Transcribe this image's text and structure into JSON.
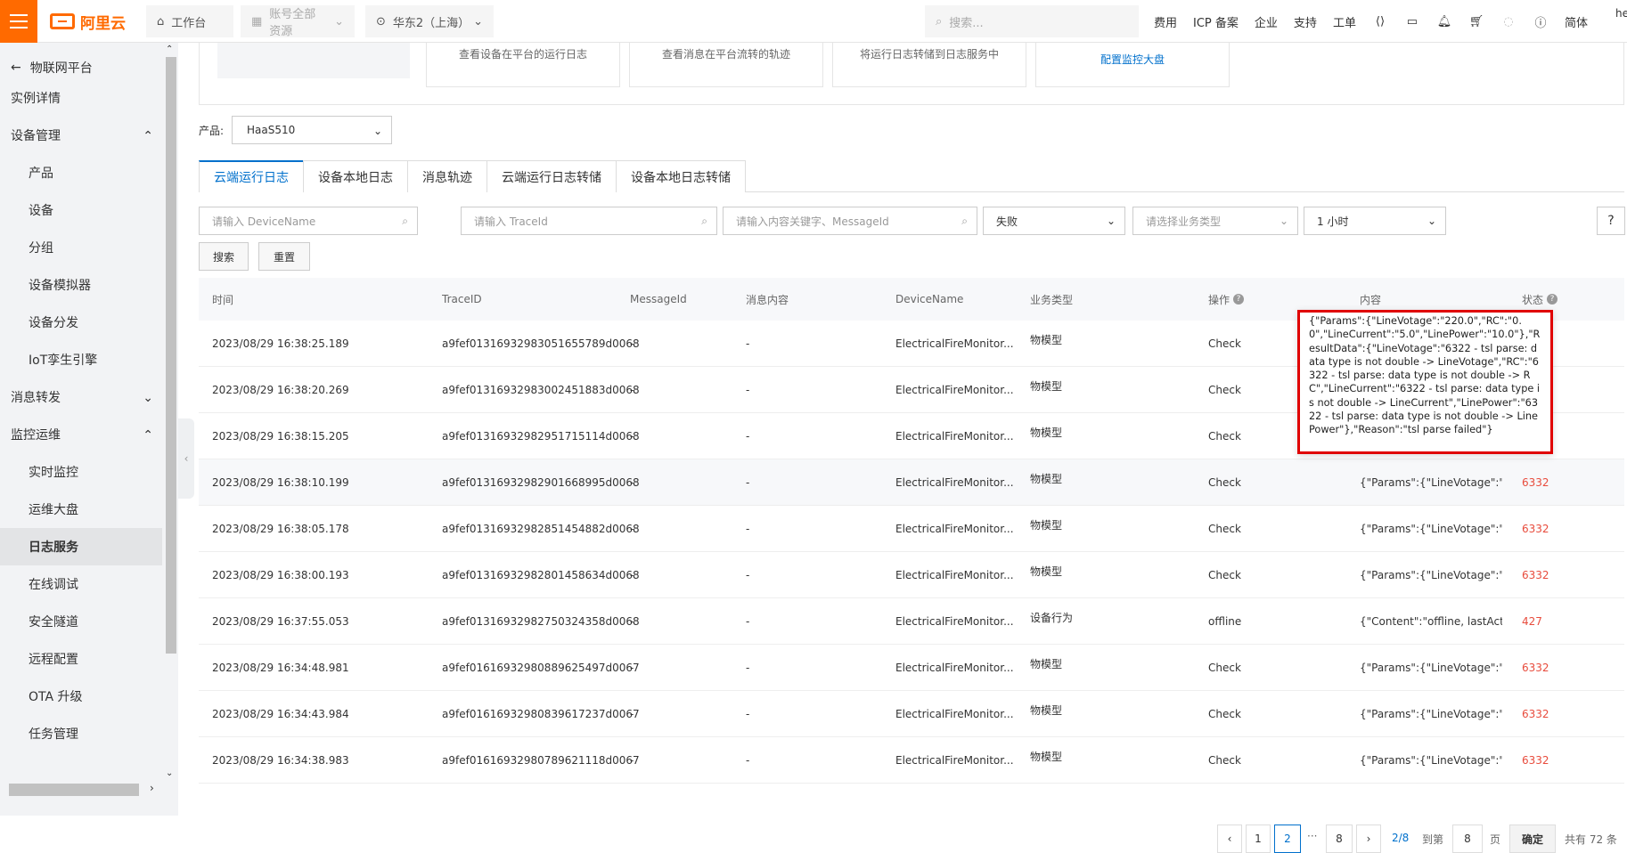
{
  "topbar": {
    "logo_text": "阿里云",
    "workbench": "工作台",
    "account": "账号全部资源",
    "region": "华东2（上海）",
    "search_placeholder": "搜索...",
    "links": [
      "费用",
      "ICP 备案",
      "企业",
      "支持",
      "工单"
    ],
    "lang": "简体",
    "user": "he"
  },
  "sidebar": {
    "back_label": "物联网平台",
    "items": [
      {
        "label": "实例详情",
        "level": "top"
      },
      {
        "label": "设备管理",
        "level": "top",
        "expanded": true
      },
      {
        "label": "产品",
        "level": "sub"
      },
      {
        "label": "设备",
        "level": "sub"
      },
      {
        "label": "分组",
        "level": "sub"
      },
      {
        "label": "设备模拟器",
        "level": "sub"
      },
      {
        "label": "设备分发",
        "level": "sub"
      },
      {
        "label": "IoT孪生引擎",
        "level": "sub"
      },
      {
        "label": "消息转发",
        "level": "top",
        "expanded": false
      },
      {
        "label": "监控运维",
        "level": "top",
        "expanded": true
      },
      {
        "label": "实时监控",
        "level": "sub"
      },
      {
        "label": "运维大盘",
        "level": "sub"
      },
      {
        "label": "日志服务",
        "level": "sub",
        "active": true
      },
      {
        "label": "在线调试",
        "level": "sub"
      },
      {
        "label": "安全隧道",
        "level": "sub"
      },
      {
        "label": "远程配置",
        "level": "sub"
      },
      {
        "label": "OTA 升级",
        "level": "sub"
      },
      {
        "label": "任务管理",
        "level": "sub"
      }
    ]
  },
  "cards": [
    {
      "text": "查看设备在平台的运行日志"
    },
    {
      "text": "查看消息在平台流转的轨迹"
    },
    {
      "text": "将运行日志转储到日志服务中"
    },
    {
      "link": "配置监控大盘"
    }
  ],
  "product": {
    "label": "产品:",
    "value": "HaaS510"
  },
  "tabs": [
    "云端运行日志",
    "设备本地日志",
    "消息轨迹",
    "云端运行日志转储",
    "设备本地日志转储"
  ],
  "filters": {
    "device_placeholder": "请输入 DeviceName",
    "trace_placeholder": "请输入 TraceId",
    "content_placeholder": "请输入内容关键字、MessageId",
    "status": "失败",
    "biz_placeholder": "请选择业务类型",
    "time": "1 小时",
    "help": "?"
  },
  "buttons": {
    "search": "搜索",
    "reset": "重置"
  },
  "table": {
    "headers": [
      "时间",
      "TraceID",
      "MessageId",
      "消息内容",
      "DeviceName",
      "业务类型",
      "操作",
      "内容",
      "状态"
    ],
    "rows": [
      {
        "time": "2023/08/29 16:38:25.189",
        "trace": "a9fef01316932983051655789d0068",
        "msg": "-",
        "content": "-",
        "device": "ElectricalFireMonitor...",
        "biz": "物模型",
        "op": "Check",
        "body": "",
        "state": ""
      },
      {
        "time": "2023/08/29 16:38:20.269",
        "trace": "a9fef01316932983002451883d0068",
        "msg": "-",
        "content": "-",
        "device": "ElectricalFireMonitor...",
        "biz": "物模型",
        "op": "Check",
        "body": "",
        "state": ""
      },
      {
        "time": "2023/08/29 16:38:15.205",
        "trace": "a9fef01316932982951715114d0068",
        "msg": "-",
        "content": "-",
        "device": "ElectricalFireMonitor...",
        "biz": "物模型",
        "op": "Check",
        "body": "",
        "state": ""
      },
      {
        "time": "2023/08/29 16:38:10.199",
        "trace": "a9fef01316932982901668995d0068",
        "msg": "-",
        "content": "-",
        "device": "ElectricalFireMonitor...",
        "biz": "物模型",
        "op": "Check",
        "body": "{\"Params\":{\"LineVotage\":\"...",
        "state": "6332"
      },
      {
        "time": "2023/08/29 16:38:05.178",
        "trace": "a9fef01316932982851454882d0068",
        "msg": "-",
        "content": "-",
        "device": "ElectricalFireMonitor...",
        "biz": "物模型",
        "op": "Check",
        "body": "{\"Params\":{\"LineVotage\":\"...",
        "state": "6332"
      },
      {
        "time": "2023/08/29 16:38:00.193",
        "trace": "a9fef01316932982801458634d0068",
        "msg": "-",
        "content": "-",
        "device": "ElectricalFireMonitor...",
        "biz": "物模型",
        "op": "Check",
        "body": "{\"Params\":{\"LineVotage\":\"...",
        "state": "6332"
      },
      {
        "time": "2023/08/29 16:37:55.053",
        "trace": "a9fef01316932982750324358d0068",
        "msg": "-",
        "content": "-",
        "device": "ElectricalFireMonitor...",
        "biz": "设备行为",
        "op": "offline",
        "body": "{\"Content\":\"offline, lastAct...",
        "state": "427"
      },
      {
        "time": "2023/08/29 16:34:48.981",
        "trace": "a9fef01616932980889625497d0067",
        "msg": "-",
        "content": "-",
        "device": "ElectricalFireMonitor...",
        "biz": "物模型",
        "op": "Check",
        "body": "{\"Params\":{\"LineVotage\":\"...",
        "state": "6332"
      },
      {
        "time": "2023/08/29 16:34:43.984",
        "trace": "a9fef01616932980839617237d0067",
        "msg": "-",
        "content": "-",
        "device": "ElectricalFireMonitor...",
        "biz": "物模型",
        "op": "Check",
        "body": "{\"Params\":{\"LineVotage\":\"...",
        "state": "6332"
      },
      {
        "time": "2023/08/29 16:34:38.983",
        "trace": "a9fef01616932980789621118d0067",
        "msg": "-",
        "content": "-",
        "device": "ElectricalFireMonitor...",
        "biz": "物模型",
        "op": "Check",
        "body": "{\"Params\":{\"LineVotage\":\"...",
        "state": "6332"
      }
    ]
  },
  "popover": {
    "text": "{\"Params\":{\"LineVotage\":\"220.0\",\"RC\":\"0.0\",\"LineCurrent\":\"5.0\",\"LinePower\":\"10.0\"},\"ResultData\":{\"LineVotage\":\"6322 - tsl parse: data type is not double -> LineVotage\",\"RC\":\"6322 - tsl parse: data type is not double -> RC\",\"LineCurrent\":\"6322 - tsl parse: data type is not double -> LineCurrent\",\"LinePower\":\"6322 - tsl parse: data type is not double -> LinePower\"},\"Reason\":\"tsl parse failed\"}"
  },
  "pagination": {
    "pages": [
      "1",
      "2",
      "8"
    ],
    "ellipsis": "···",
    "current": "2/8",
    "goto_label": "到第",
    "goto_value": "8",
    "page_unit": "页",
    "confirm": "确定",
    "total": "共有 72 条"
  },
  "colors": {
    "brand": "#ff6a00",
    "link": "#0070cc",
    "error": "#e84c3d",
    "highlight_border": "#e00000"
  }
}
